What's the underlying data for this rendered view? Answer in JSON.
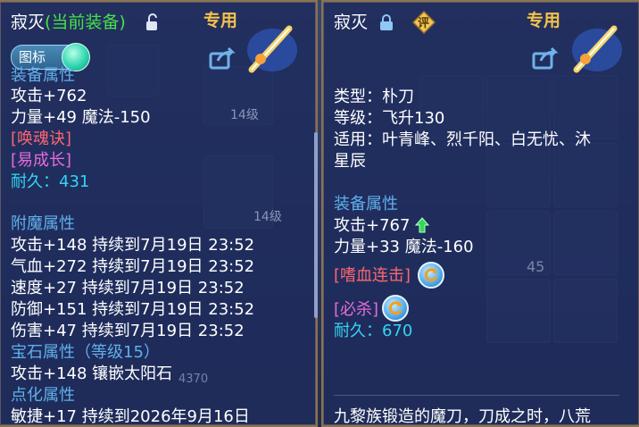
{
  "left_panel": {
    "item_name": "寂灭",
    "current_equip_tag": "(当前装备)",
    "exclusive_label": "专用",
    "icon_toggle_label": "图标",
    "base_section_title": "装备属性",
    "base_stats": [
      "攻击+762",
      "力量+49 魔法-150"
    ],
    "skills": [
      "[唤魂诀]",
      "[易成长]"
    ],
    "durability_label": "耐久：",
    "durability_value": "431",
    "enchant_section_title": "附魔属性",
    "enchant_stats": [
      "攻击+148 持续到7月19日 23:52",
      "气血+272 持续到7月19日 23:52",
      "速度+27 持续到7月19日 23:52",
      "防御+151 持续到7月19日 23:52",
      "伤害+47 持续到7月19日 23:52"
    ],
    "gem_section_title": "宝石属性（等级15）",
    "gem_stat": "攻击+148 镶嵌太阳石",
    "refine_section_title": "点化属性",
    "refine_stat": "敏捷+17 持续到2026年9月16日"
  },
  "right_panel": {
    "item_name": "寂灭",
    "rate_badge": "评",
    "exclusive_label": "专用",
    "type_line": "类型：朴刀",
    "level_line": "等级：飞升130",
    "fit_line_1": "适用：叶青峰、烈千阳、白无忧、沐",
    "fit_line_2": "星辰",
    "base_section_title": "装备属性",
    "base_stats": [
      "攻击+767",
      "力量+33 魔法-160"
    ],
    "skill_red": "[嗜血连击]",
    "skill_pink": "[必杀]",
    "durability_label": "耐久：",
    "durability_value": "670",
    "description": "九黎族锻造的魔刀，刀成之时，八荒"
  },
  "background": {
    "level_badges": [
      "14级",
      "14级"
    ],
    "count": "45",
    "bar_value": "4370"
  },
  "colors": {
    "panel_bg": "#1e2c5c",
    "panel_border": "#8a7350",
    "current_tag": "#47e04a",
    "exclusive": "#f3c24a",
    "section": "#5fb0ea",
    "skill_pink": "#e66bd8",
    "skill_red": "#ff6570",
    "durability": "#34d4f2"
  },
  "icons": [
    "unlock-icon",
    "lock-icon",
    "share-icon",
    "weapon-thumbnail-icon",
    "up-arrow-icon",
    "refresh-icon"
  ]
}
